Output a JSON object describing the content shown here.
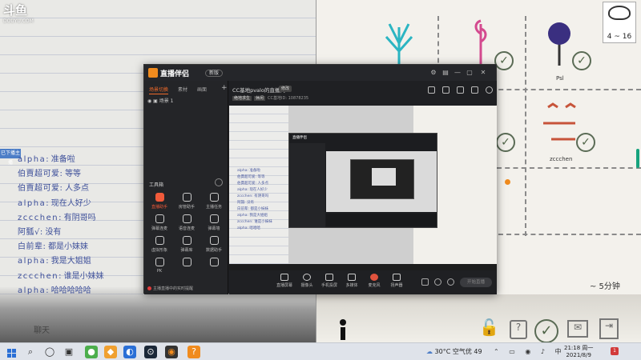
{
  "stream": {
    "logo": "斗鱼",
    "logo_sub": "DOUYU.COM",
    "side_tag": "已下播主播",
    "chat": [
      {
        "user": "alpha",
        "sep": ": ",
        "text": "准备啦"
      },
      {
        "user": "伯賈超可爱",
        "sep": ": ",
        "text": "等等"
      },
      {
        "user": "伯賈超可爱",
        "sep": ": ",
        "text": "人多点"
      },
      {
        "user": "alpha",
        "sep": ": ",
        "text": "现在人好少"
      },
      {
        "user": "zccchen",
        "sep": ": ",
        "text": "有阴哥吗"
      },
      {
        "user": "阿瓢√",
        "sep": ": ",
        "text": "没有"
      },
      {
        "user": "白前辈",
        "sep": ": ",
        "text": "都是小妹妹"
      },
      {
        "user": "alpha",
        "sep": ": ",
        "text": "我是大姐姐"
      },
      {
        "user": "zccchen",
        "sep": ": ",
        "text": "谁是小妹妹"
      },
      {
        "user": "alpha",
        "sep": ": ",
        "text": "哈哈哈哈哈"
      }
    ],
    "chat_label": "聊天",
    "counter": "4 ~ 16",
    "timer": "~ 5分钟",
    "drawing_label_1": "Psl",
    "drawing_label_2": "zccchen"
  },
  "app": {
    "title": "直播伴侣",
    "version": "新版",
    "left_tabs": [
      "场景切换",
      "素材",
      "画面"
    ],
    "scene_name": "场景 1",
    "tools_label": "工具箱",
    "tools": [
      {
        "label": "直播助手",
        "icon": "broadcast-icon",
        "active": true
      },
      {
        "label": "房管助手",
        "icon": "person-icon",
        "active": false
      },
      {
        "label": "主播任务",
        "icon": "clipboard-icon",
        "active": false
      },
      {
        "label": "弹幕连麦",
        "icon": "heart-link-icon",
        "active": false
      },
      {
        "label": "语音连麦",
        "icon": "people-icon",
        "active": false
      },
      {
        "label": "弹幕墙",
        "icon": "chat-icon",
        "active": false
      },
      {
        "label": "虚拟形象",
        "icon": "avatar-icon",
        "active": false
      },
      {
        "label": "弹幕库",
        "icon": "library-icon",
        "active": false
      },
      {
        "label": "数据助手",
        "icon": "data-icon",
        "active": false
      },
      {
        "label": "PK",
        "icon": "pk-icon",
        "active": false
      },
      {
        "label": "",
        "icon": "more-icon",
        "active": false
      },
      {
        "label": "",
        "icon": "home-icon",
        "active": false
      }
    ],
    "status": "主播直播中的实时提醒",
    "room_title": "CC基地pvalo的直播间",
    "room_tag": "修改",
    "room_meta_chip1": "绝地求生",
    "room_meta_chip2": "休闲",
    "room_meta_id": "CC基地ID: 10878235",
    "bottom_buttons": [
      {
        "label": "直播屏幕",
        "icon": "screen-icon"
      },
      {
        "label": "摄像头",
        "icon": "camera-icon"
      },
      {
        "label": "手机投屏",
        "icon": "phone-cast-icon"
      },
      {
        "label": "多媒体",
        "icon": "media-icon"
      },
      {
        "label": "麦克风",
        "icon": "mic-icon"
      },
      {
        "label": "扬声器",
        "icon": "speaker-icon"
      }
    ],
    "start_live": "开始直播"
  },
  "preview_chat": [
    "alpha: 准备啦",
    "伯賈超可爱: 等等",
    "伯賈超可爱: 人多点",
    "alpha: 现在人好少",
    "zccchen: 有阴哥吗",
    "阿瓢: 没有",
    "白前辈: 都是小妹妹",
    "alpha: 我是大姐姐",
    "zccchen: 谁是小妹妹",
    "alpha: 哈哈哈"
  ],
  "taskbar": {
    "weather": "30°C 空气优 49",
    "time": "21:18 周一",
    "date": "2021/8/9",
    "notifications": "1"
  },
  "colors": {
    "accent": "#f06a2a",
    "chat_text": "#3d4f9a",
    "app_bg": "#1e1f22"
  }
}
